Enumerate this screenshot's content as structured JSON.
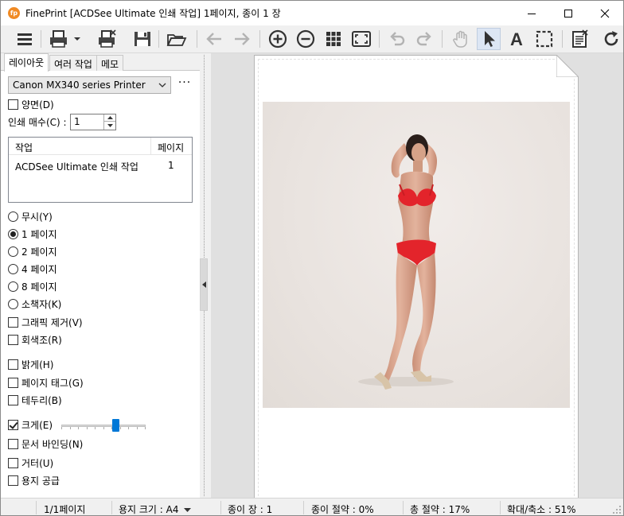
{
  "window": {
    "title": "FinePrint [ACDSee Ultimate 인쇄 작업] 1페이지, 종이 1 장",
    "app_icon_text": "fp"
  },
  "toolbar": {
    "icons": [
      "menu-icon",
      "printer-icon",
      "print-delete-icon",
      "save-icon",
      "open-folder-icon",
      "arrow-left-icon",
      "arrow-right-icon",
      "zoom-in-icon",
      "zoom-out-icon",
      "grid-icon",
      "fit-page-icon",
      "undo-icon",
      "redo-icon",
      "hand-icon",
      "pointer-icon",
      "text-icon",
      "select-rect-icon",
      "page-edit-icon",
      "refresh-icon"
    ],
    "text_tool_glyph": "A"
  },
  "tabs": [
    {
      "label": "레이아웃",
      "active": true
    },
    {
      "label": "여러 작업",
      "active": false
    },
    {
      "label": "메모",
      "active": false
    }
  ],
  "printer": {
    "selected": "Canon MX340 series Printer",
    "more": "···"
  },
  "duplex": {
    "label": "양면(D)",
    "checked": false
  },
  "copies": {
    "label": "인쇄 매수(C) :",
    "value": "1"
  },
  "jobs": {
    "headers": [
      "작업",
      "페이지"
    ],
    "rows": [
      {
        "name": "ACDSee Ultimate 인쇄 작업",
        "pages": "1"
      }
    ]
  },
  "layout_options": [
    {
      "label": "무시(Y)",
      "checked": false
    },
    {
      "label": "1 페이지",
      "checked": true
    },
    {
      "label": "2 페이지",
      "checked": false
    },
    {
      "label": "4 페이지",
      "checked": false
    },
    {
      "label": "8 페이지",
      "checked": false
    },
    {
      "label": "소책자(K)",
      "checked": false
    }
  ],
  "checkboxes_top": [
    {
      "label": "그래픽 제거(V)",
      "checked": false
    },
    {
      "label": "회색조(R)",
      "checked": false
    }
  ],
  "checkboxes_bottom": [
    {
      "label": "밝게(H)",
      "checked": false
    },
    {
      "label": "페이지 태그(G)",
      "checked": false
    },
    {
      "label": "테두리(B)",
      "checked": false
    },
    {
      "label": "크게(E)",
      "checked": true
    },
    {
      "label": "문서 바인딩(N)",
      "checked": false
    },
    {
      "label": "거터(U)",
      "checked": false
    },
    {
      "label": "용지 공급",
      "checked": false
    }
  ],
  "enlarge_slider": {
    "value_fraction": 0.66
  },
  "status": {
    "page": "1/1페이지",
    "paper_size": "용지 크기 : A4",
    "sheets": "종이 장 : 1",
    "paper_saving": "종이 절약 : 0%",
    "total_saving": "총 절약 : 17%",
    "zoom": "확대/축소 : 51%"
  }
}
